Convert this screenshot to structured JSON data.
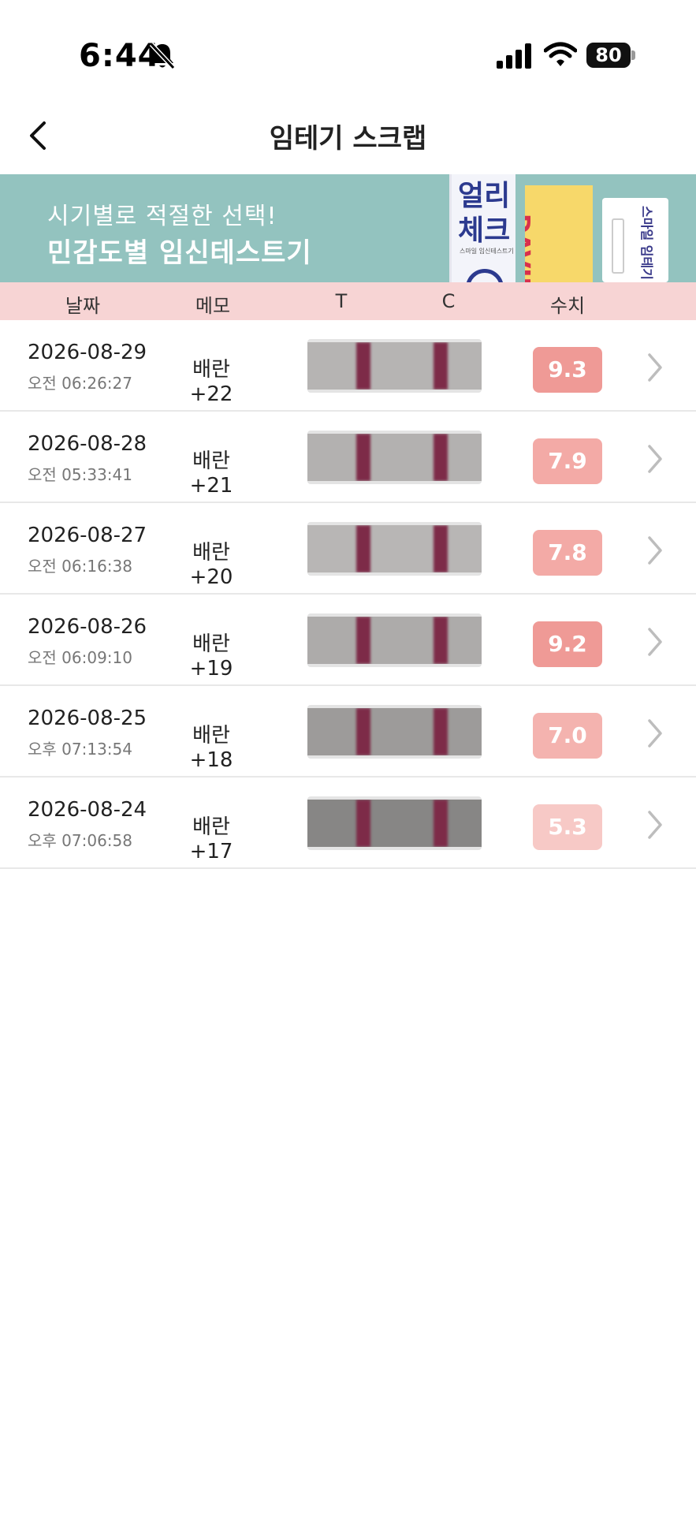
{
  "status": {
    "time": "6:44",
    "battery": "80"
  },
  "nav": {
    "title": "임테기 스크랩"
  },
  "banner": {
    "line1": "시기별로 적절한 선택!",
    "line2": "민감도별 임신테스트기",
    "box1_title": "얼리\n체크",
    "box1_sub": "스마일 임신테스트기",
    "box2_text": "DAVID -SUPER",
    "box3_text": "스마일 임테기"
  },
  "table": {
    "headers": {
      "date": "날짜",
      "memo": "메모",
      "t": "T",
      "c": "C",
      "value": "수치"
    },
    "rows": [
      {
        "date": "2026-08-29",
        "time": "오전 06:26:27",
        "memo": "배란+22",
        "value": "9.3",
        "badge_color": "#ef9a96",
        "strip_bg": "#b6b4b3"
      },
      {
        "date": "2026-08-28",
        "time": "오전 05:33:41",
        "memo": "배란+21",
        "value": "7.9",
        "badge_color": "#f3aaa6",
        "strip_bg": "#b3b1b0"
      },
      {
        "date": "2026-08-27",
        "time": "오전 06:16:38",
        "memo": "배란+20",
        "value": "7.8",
        "badge_color": "#f3aaa6",
        "strip_bg": "#b8b6b5"
      },
      {
        "date": "2026-08-26",
        "time": "오전 06:09:10",
        "memo": "배란+19",
        "value": "9.2",
        "badge_color": "#ef9a96",
        "strip_bg": "#adabaa"
      },
      {
        "date": "2026-08-25",
        "time": "오후 07:13:54",
        "memo": "배란+18",
        "value": "7.0",
        "badge_color": "#f4b3af",
        "strip_bg": "#9d9b9a"
      },
      {
        "date": "2026-08-24",
        "time": "오후 07:06:58",
        "memo": "배란+17",
        "value": "5.3",
        "badge_color": "#f7c9c6",
        "strip_bg": "#878685"
      }
    ]
  }
}
